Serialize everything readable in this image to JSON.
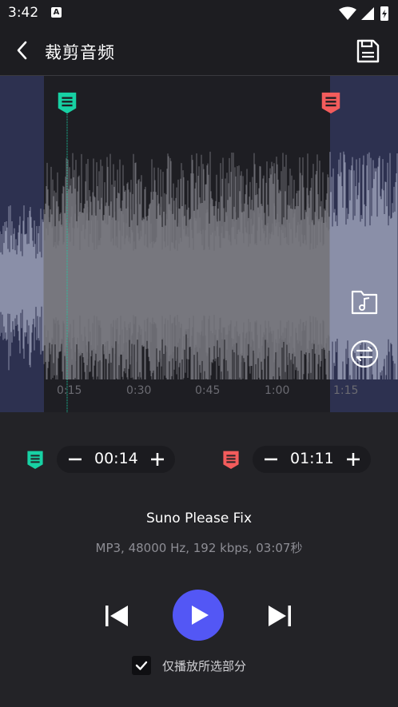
{
  "status": {
    "time": "3:42",
    "notification_letter": "A"
  },
  "header": {
    "title": "裁剪音频",
    "back_icon": "chevron-left-icon",
    "save_icon": "floppy-disk-icon"
  },
  "timeline": {
    "ticks": [
      "0:15",
      "0:30",
      "0:45",
      "1:00",
      "1:15"
    ]
  },
  "markers": {
    "start_color": "#17d1a4",
    "end_color": "#f35c5c"
  },
  "trim": {
    "start": "00:14",
    "end": "01:11",
    "minus": "−",
    "plus": "+"
  },
  "track": {
    "name": "Suno Please Fix",
    "info": "MP3, 48000 Hz, 192 kbps, 03:07秒"
  },
  "playback": {
    "only_selected_label": "仅播放所选部分",
    "only_selected_checked": true
  },
  "colors": {
    "accent": "#5357f5",
    "background": "#232327"
  }
}
